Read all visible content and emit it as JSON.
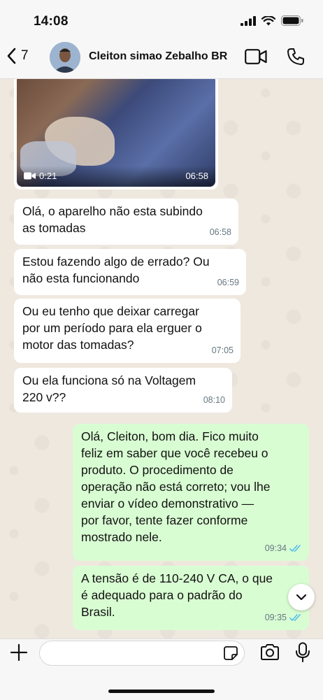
{
  "status": {
    "time": "14:08"
  },
  "header": {
    "back_count": "7",
    "contact_name": "Cleiton simao Zebalho BR"
  },
  "video": {
    "duration": "0:21",
    "time": "06:58"
  },
  "messages": [
    {
      "dir": "in",
      "text": "Olá, o aparelho não esta subindo\nas tomadas",
      "time": "06:58"
    },
    {
      "dir": "in",
      "text": "Estou fazendo algo de errado? Ou\nnão esta funcionando",
      "time": "06:59"
    },
    {
      "dir": "in",
      "text": "Ou eu tenho que deixar carregar\npor um período para ela erguer o\nmotor das tomadas?",
      "time": "07:05"
    },
    {
      "dir": "in",
      "text": "Ou ela funciona só na Voltagem\n220 v??",
      "time": "08:10"
    },
    {
      "dir": "out",
      "text": "Olá, Cleiton, bom dia. Fico muito\nfeliz em saber que você recebeu o\nproduto. O procedimento de\noperação não está correto; vou lhe\nenviar o vídeo demonstrativo —\npor favor, tente fazer conforme\nmostrado nele.",
      "time": "09:34"
    },
    {
      "dir": "out",
      "text": "A tensão é de 110-240 V CA, o que\né adequado para o padrão do\nBrasil.",
      "time": "09:35"
    }
  ],
  "composer": {
    "placeholder": ""
  },
  "colors": {
    "incoming": "#ffffff",
    "outgoing": "#d9fdd3",
    "read_ticks": "#53bdeb",
    "background": "#efe8df"
  },
  "icons": [
    "signal-icon",
    "wifi-icon",
    "battery-icon",
    "back-chevron-icon",
    "video-call-icon",
    "phone-icon",
    "video-camera-icon",
    "double-check-icon",
    "chevron-down-icon",
    "plus-icon",
    "sticker-icon",
    "camera-icon",
    "microphone-icon"
  ]
}
